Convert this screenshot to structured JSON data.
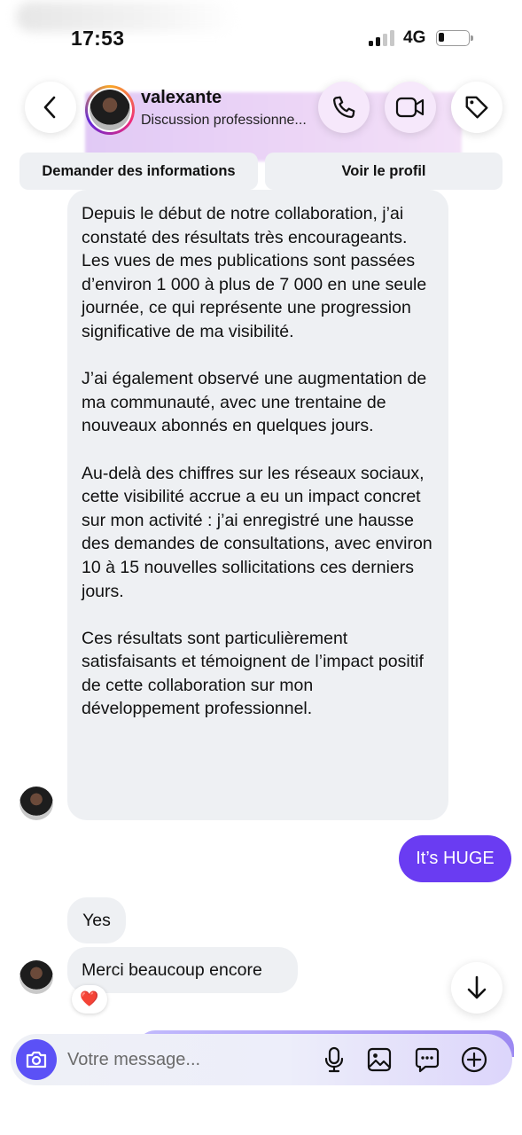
{
  "status_bar": {
    "time": "17:53",
    "network": "4G",
    "signal_bars": 2,
    "signal_total": 4,
    "battery_level": 0.2
  },
  "header": {
    "username": "valexante",
    "subtitle": "Discussion professionne...",
    "back_icon": "chevron-left-icon",
    "call_icon": "phone-icon",
    "video_icon": "video-camera-icon",
    "tag_icon": "tag-icon"
  },
  "tabs": {
    "request_info": "Demander des informations",
    "view_profile": "Voir le profil"
  },
  "messages": {
    "long_paragraphs": [
      "Depuis le début de notre collaboration, j’ai constaté des résultats très encourageants. Les vues de mes publications sont passées d’environ 1 000 à plus de 7 000 en une seule journée, ce qui représente une progression significative de ma visibilité.",
      "J’ai également observé une augmentation de ma communauté, avec une trentaine de nouveaux abonnés en quelques jours.",
      "Au-delà des chiffres sur les réseaux sociaux, cette visibilité accrue a eu un impact concret sur mon activité : j’ai enregistré une hausse des demandes de consultations, avec environ 10 à 15 nouvelles sollicitations ces derniers jours.",
      "Ces résultats sont particulièrement satisfaisants et témoignent de l’impact positif de cette collaboration sur mon développement professionnel."
    ],
    "outgoing": "It’s HUGE",
    "yes": "Yes",
    "thanks": "Merci beaucoup encore",
    "reaction": "❤️"
  },
  "composer": {
    "placeholder": "Votre message...",
    "icons": [
      "camera-icon",
      "microphone-icon",
      "image-icon",
      "sticker-icon",
      "plus-circle-icon"
    ]
  },
  "colors": {
    "outgoing_bubble": "#6a3cf2",
    "incoming_bubble": "#eef0f3",
    "camera_button": "#5b51f6"
  }
}
